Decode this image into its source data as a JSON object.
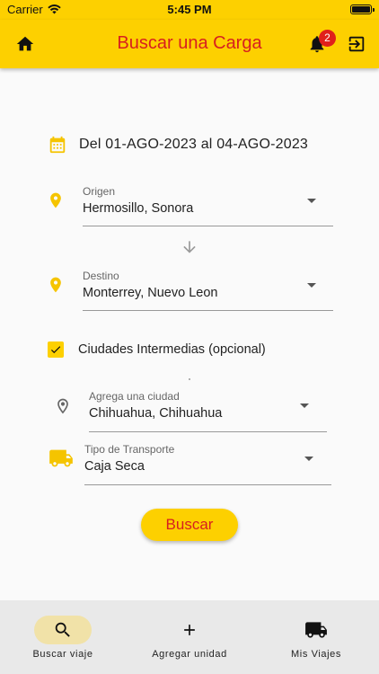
{
  "status_bar": {
    "carrier": "Carrier",
    "time": "5:45 PM"
  },
  "header": {
    "title": "Buscar una Carga",
    "notification_count": "2"
  },
  "date_range": "Del 01-AGO-2023 al 04-AGO-2023",
  "origen": {
    "label": "Origen",
    "value": "Hermosillo, Sonora"
  },
  "destino": {
    "label": "Destino",
    "value": "Monterrey, Nuevo Leon"
  },
  "intermedias": {
    "label": "Ciudades Intermedias (opcional)",
    "checked": true
  },
  "ciudad": {
    "label": "Agrega una ciudad",
    "value": "Chihuahua, Chihuahua"
  },
  "transporte": {
    "label": "Tipo de Transporte",
    "value": "Caja Seca"
  },
  "search_button": "Buscar",
  "bottom_nav": [
    {
      "label": "Buscar viaje",
      "icon": "search-icon",
      "active": true
    },
    {
      "label": "Agregar unidad",
      "icon": "plus-icon",
      "active": false
    },
    {
      "label": "Mis Viajes",
      "icon": "truck-icon",
      "active": false
    }
  ],
  "colors": {
    "accent": "#FDD000",
    "title_red": "#D71F1F",
    "badge_red": "#E0201B"
  }
}
